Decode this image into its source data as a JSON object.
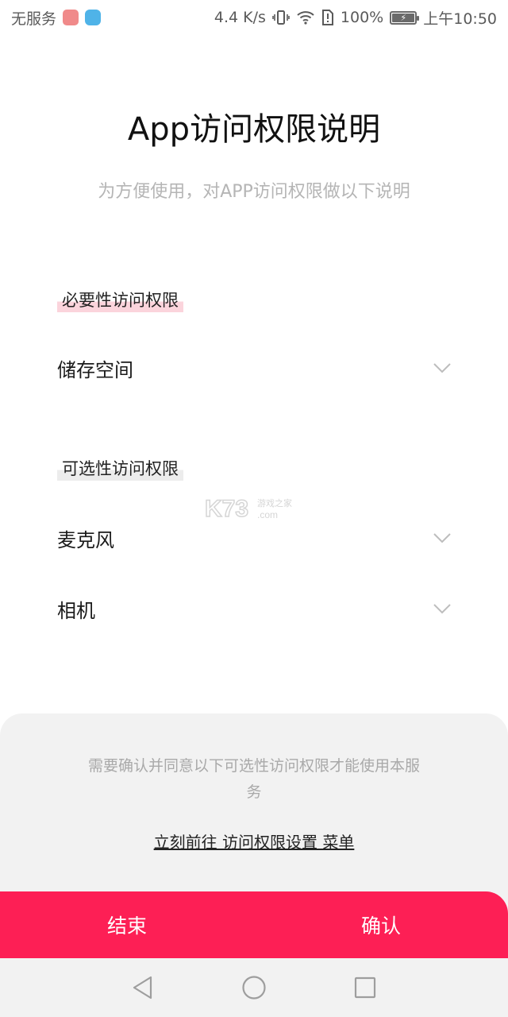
{
  "status_bar": {
    "carrier": "无服务",
    "speed": "4.4 K/s",
    "battery": "100%",
    "time": "上午10:50",
    "icons": [
      "huawei-app-icon",
      "shield-app-icon",
      "vibrate-icon",
      "wifi-icon",
      "sim-alert-icon",
      "battery-charging-icon"
    ]
  },
  "header": {
    "title": "App访问权限说明",
    "subtitle": "为方便使用，对APP访问权限做以下说明"
  },
  "sections": {
    "required": {
      "label": "必要性访问权限",
      "items": [
        {
          "label": "储存空间",
          "icon": "chevron-down-icon"
        }
      ]
    },
    "optional": {
      "label": "可选性访问权限",
      "items": [
        {
          "label": "麦克风",
          "icon": "chevron-down-icon"
        },
        {
          "label": "相机",
          "icon": "chevron-down-icon"
        }
      ]
    }
  },
  "watermark": {
    "text_main": "K73",
    "text_cn": "游戏之家",
    "text_domain": ".com"
  },
  "bottom": {
    "notice": "需要确认并同意以下可选性访问权限才能使用本服务",
    "settings_link": "立刻前往 访问权限设置 菜单",
    "end_button": "结束",
    "confirm_button": "确认"
  },
  "nav": {
    "icons": [
      "back-icon",
      "home-icon",
      "recents-icon"
    ]
  },
  "colors": {
    "accent": "#fd1f55",
    "required_highlight": "#fbd4dc",
    "optional_highlight": "#ececec",
    "panel_bg": "#f2f2f2"
  }
}
